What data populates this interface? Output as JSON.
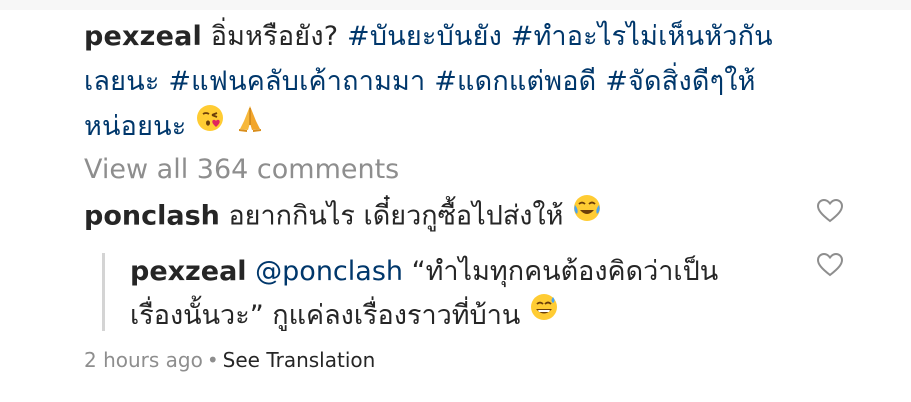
{
  "caption": {
    "username": "pexzeal",
    "text": "อิ่มหรือยัง?",
    "hashtags_line1": [
      "#บันยะบันยัง",
      "#ทำอะไรไม่เห็นหัวกัน"
    ],
    "hashtags_line2": [
      "เลยนะ",
      "#แฟนคลับเค้าถามมา",
      "#แดกแต่พอดี",
      "#จัดสิ่งดีๆให้"
    ],
    "line3": "หน่อยนะ"
  },
  "view_all_comments": "View all 364 comments",
  "comment": {
    "username": "ponclash",
    "text": "อยากกินไร เดี๋ยวกูซื้อไปส่งให้"
  },
  "reply": {
    "username": "pexzeal",
    "mention": "@ponclash",
    "text_line1": "“ทำไมทุกคนต้องคิดว่าเป็น",
    "text_line2": "เรื่องนั้นวะ” กูแค่ลงเรื่องราวที่บ้าน"
  },
  "meta": {
    "time": "2 hours ago",
    "see_translation": "See Translation"
  },
  "icons": {
    "caption_emoji_1": "face-blowing-kiss",
    "caption_emoji_2": "folded-hands",
    "comment_emoji": "face-with-tears-of-joy",
    "reply_emoji": "grinning-face-with-sweat",
    "like": "heart-outline"
  },
  "colors": {
    "text": "#262626",
    "link": "#00376b",
    "muted": "#8e8e8e"
  }
}
